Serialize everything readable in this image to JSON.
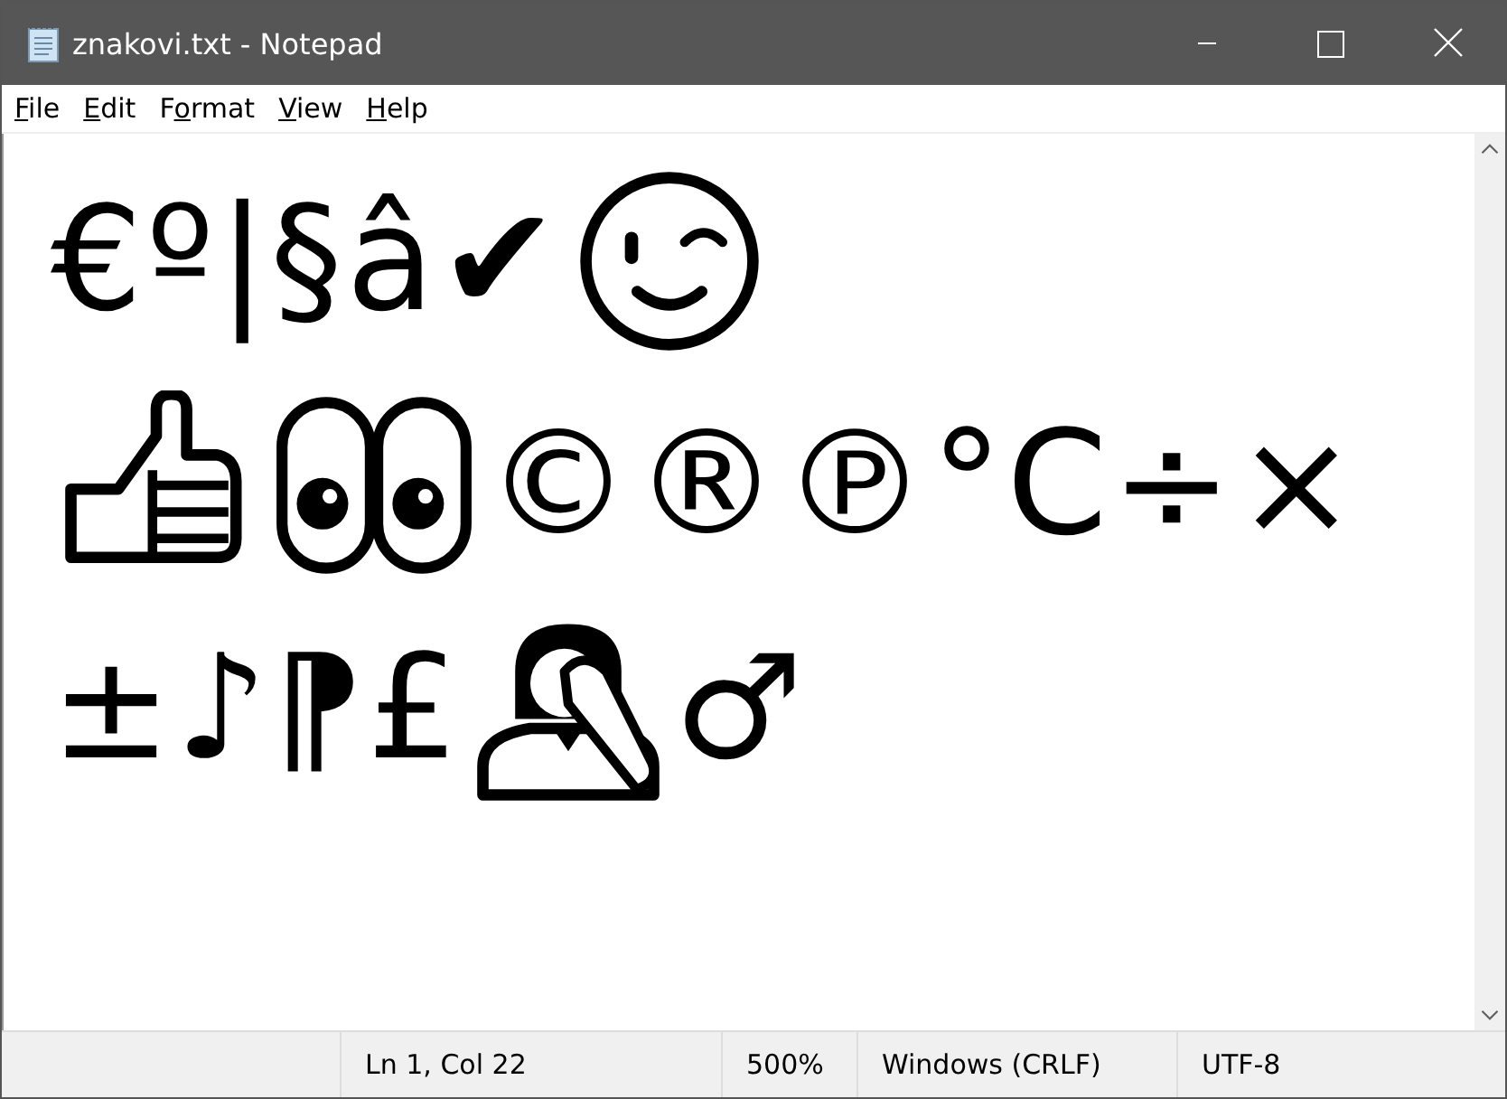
{
  "window": {
    "title": "znakovi.txt - Notepad"
  },
  "menu": [
    {
      "key": "F",
      "post": "ile"
    },
    {
      "key": "E",
      "post": "dit"
    },
    {
      "pre": "F",
      "key": "o",
      "post": "rmat"
    },
    {
      "key": "V",
      "post": "iew"
    },
    {
      "key": "H",
      "post": "elp"
    }
  ],
  "editor": {
    "lines": [
      [
        {
          "kind": "text",
          "text": "€º|§â✔"
        },
        {
          "kind": "wink-face"
        }
      ],
      [
        {
          "kind": "thumbs-up"
        },
        {
          "kind": "eyes"
        },
        {
          "kind": "text",
          "text": "©®℗°C÷×"
        }
      ],
      [
        {
          "kind": "text",
          "text": "±♪⁋£"
        },
        {
          "kind": "facepalm"
        },
        {
          "kind": "text",
          "text": "♂"
        }
      ]
    ]
  },
  "status_bar": [
    "Ln 1, Col 22",
    "500%",
    "Windows (CRLF)",
    "UTF-8"
  ]
}
